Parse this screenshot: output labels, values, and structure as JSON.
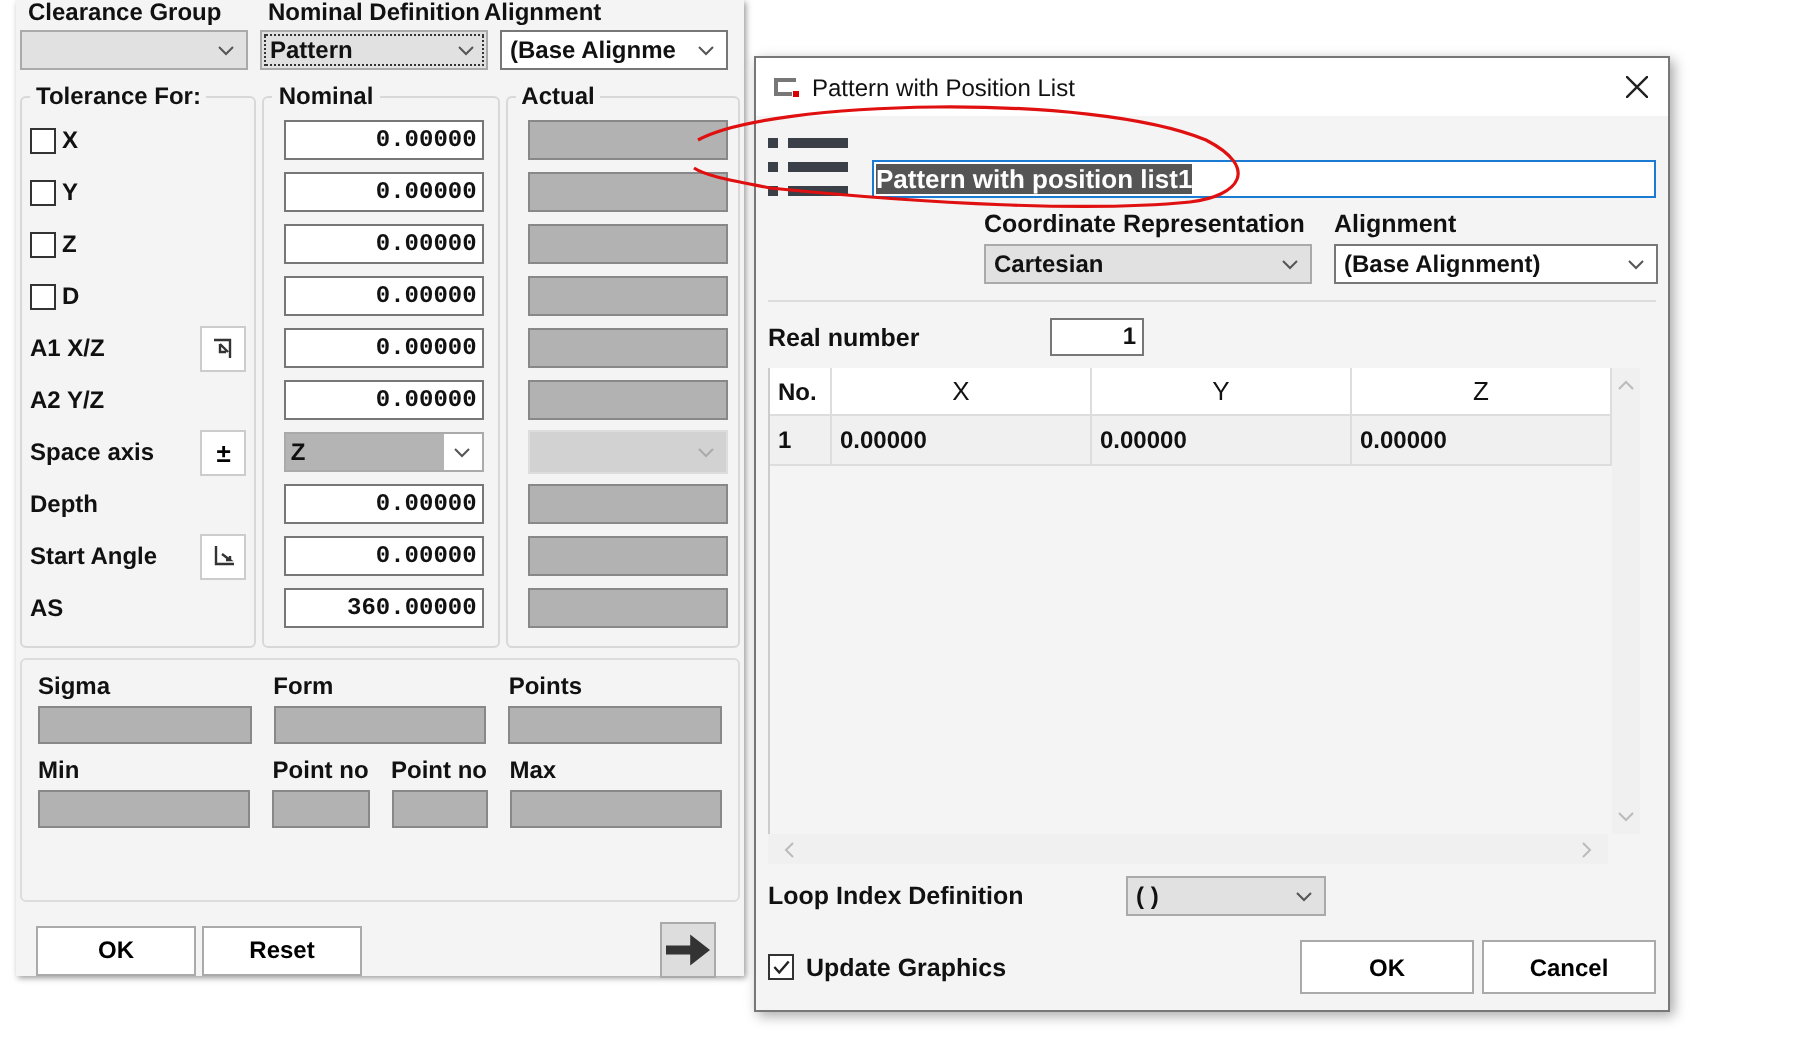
{
  "left_panel": {
    "header_labels": [
      "Clearance Group",
      "Nominal Definition",
      "Alignment"
    ],
    "selects": [
      {
        "kind": "combo",
        "focused": false
      },
      {
        "kind": "combo",
        "value": "Pattern",
        "focused": true
      },
      {
        "kind": "list",
        "value": "(Base Alignme",
        "focused": false
      }
    ],
    "tolerance": {
      "title": "Tolerance For:",
      "rows": [
        {
          "kind": "checkbox",
          "label": "X",
          "checked": false
        },
        {
          "kind": "checkbox",
          "label": "Y",
          "checked": false
        },
        {
          "kind": "checkbox",
          "label": "Z",
          "checked": false
        },
        {
          "kind": "checkbox",
          "label": "D",
          "checked": false
        },
        {
          "kind": "corner",
          "label": "A1 X/Z"
        },
        {
          "kind": "plain",
          "label": "A2 Y/Z"
        },
        {
          "kind": "text_button",
          "label": "Space axis",
          "button": "±"
        },
        {
          "kind": "plain",
          "label": "Depth"
        },
        {
          "kind": "angle",
          "label": "Start Angle"
        },
        {
          "kind": "plain",
          "label": "AS"
        }
      ]
    },
    "nominal": {
      "title": "Nominal",
      "rows": [
        {
          "kind": "input",
          "value": "0.00000"
        },
        {
          "kind": "input",
          "value": "0.00000"
        },
        {
          "kind": "input",
          "value": "0.00000"
        },
        {
          "kind": "input",
          "value": "0.00000"
        },
        {
          "kind": "input",
          "value": "0.00000"
        },
        {
          "kind": "input",
          "value": "0.00000"
        },
        {
          "kind": "select",
          "value": "Z"
        },
        {
          "kind": "input",
          "value": "0.00000"
        },
        {
          "kind": "input",
          "value": "0.00000"
        },
        {
          "kind": "input",
          "value": "360.00000"
        }
      ]
    },
    "actual": {
      "title": "Actual",
      "rows": [
        {
          "kind": "field"
        },
        {
          "kind": "field"
        },
        {
          "kind": "field"
        },
        {
          "kind": "field"
        },
        {
          "kind": "field"
        },
        {
          "kind": "field"
        },
        {
          "kind": "select"
        },
        {
          "kind": "field"
        },
        {
          "kind": "field"
        },
        {
          "kind": "field"
        }
      ]
    },
    "stats": [
      [
        {
          "label": "Sigma",
          "kind": "wide"
        },
        {
          "label": "Form",
          "kind": "wide"
        },
        {
          "label": "Points",
          "kind": "wide"
        }
      ],
      [
        {
          "label": "Min",
          "kind": "wide"
        },
        {
          "label": "Point no",
          "kind": "narrow"
        },
        {
          "label": "Point no",
          "kind": "narrow"
        },
        {
          "label": "Max",
          "kind": "wide"
        }
      ]
    ],
    "buttons": [
      "OK",
      "Reset"
    ]
  },
  "dialog": {
    "title": "Pattern with Position List",
    "name_field": {
      "value": "Pattern with position list1",
      "text_selected": true
    },
    "coordinate_label": "Coordinate Representation",
    "alignment_label": "Alignment",
    "coordinate_select": {
      "value": "Cartesian",
      "kind": "combo"
    },
    "alignment_select": {
      "value": "(Base Alignment)",
      "kind": "list"
    },
    "real_number": {
      "label": "Real number",
      "value": "1"
    },
    "table": {
      "columns": [
        "No.",
        "X",
        "Y",
        "Z"
      ],
      "rows": [
        [
          "1",
          "0.00000",
          "0.00000",
          "0.00000"
        ]
      ]
    },
    "loop_index": {
      "label": "Loop Index Definition",
      "value": "( )"
    },
    "update_graphics": {
      "label": "Update Graphics",
      "checked": true
    },
    "buttons": [
      "OK",
      "Cancel"
    ]
  }
}
